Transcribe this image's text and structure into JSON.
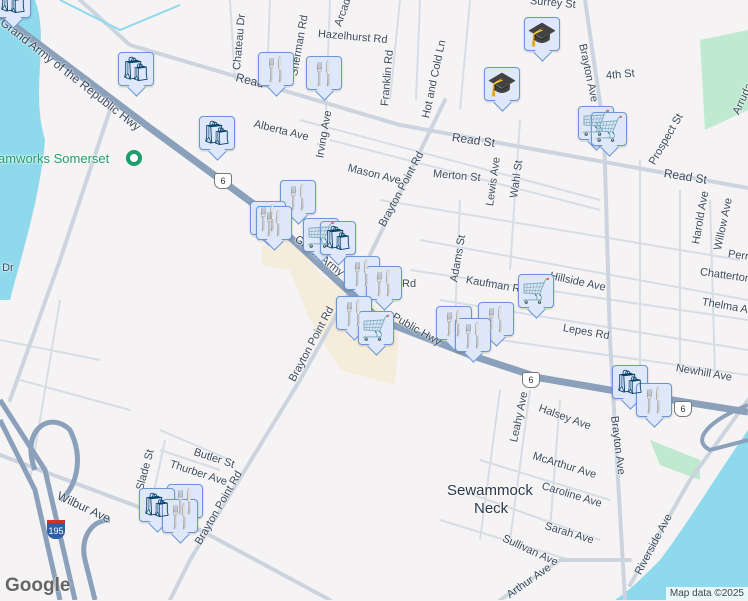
{
  "roads": {
    "grand_army": "Grand Army of the Republic Hwy",
    "grand_army_short": "Grand Army",
    "public_hwy": "Public Hwy",
    "read_st": "Read St",
    "read_st_short": "Read",
    "brayton_point_rd": "Brayton Point Rd",
    "brayton_ave": "Brayton Ave",
    "chateau_dr": "Chateau Dr",
    "sherman_rd": "Sherman Rd",
    "arcade": "Arcade",
    "hazelhurst_rd": "Hazelhurst Rd",
    "franklin_rd": "Franklin Rd",
    "hot_and_cold_ln": "Hot and Cold Ln",
    "surrey_st": "Surrey St",
    "fourth_st": "4th St",
    "alberta_ave": "Alberta Ave",
    "irving_ave": "Irving Ave",
    "mason_ave": "Mason Ave",
    "merton_st": "Merton St",
    "lewis_ave": "Lewis Ave",
    "wahl_st": "Wahl St",
    "prospect_st": "Prospect St",
    "harold_ave": "Harold Ave",
    "willow_ave": "Willow Ave",
    "arruda": "Arruda",
    "adams_st": "Adams St",
    "kaufman_rd": "Kaufman Rd",
    "hillside_ave": "Hillside Ave",
    "chatterton": "Chatterton",
    "perre": "Perre",
    "thelma_ave": "Thelma Ave",
    "lepes_rd": "Lepes Rd",
    "newhill_ave": "Newhill Ave",
    "halsey_ave": "Halsey Ave",
    "leahy_ave": "Leahy Ave",
    "mcarthur_ave": "McArthur Ave",
    "caroline_ave": "Caroline Ave",
    "sarah_ave": "Sarah Ave",
    "sullivan_ave": "Sullivan Ave",
    "arthur_ave": "Arthur Ave",
    "riverside_ave": "Riverside Ave",
    "wilbur_ave": "Wilbur Ave",
    "slade_st": "Slade St",
    "butler_st": "Butler St",
    "thurber_ave": "Thurber Ave",
    "rd_fragment": "Rd",
    "dr_fragment": "t Dr"
  },
  "shields": {
    "us6": "6",
    "i195": "195"
  },
  "places": {
    "poi": "amworks Somerset",
    "neighborhood": "Sewammock Neck"
  },
  "icons": {
    "shopping": "🛍",
    "restaurant": "🍴",
    "grocery": "🛒",
    "school": "🎓"
  },
  "branding": {
    "logo": "Google",
    "attribution": "Map data ©2025"
  },
  "colors": {
    "water": "#8fd9ec",
    "park": "#bfeacf",
    "highway": "#8aa0bb",
    "marker_fill": "#dfe8fb",
    "marker_icon": "#08436a"
  }
}
